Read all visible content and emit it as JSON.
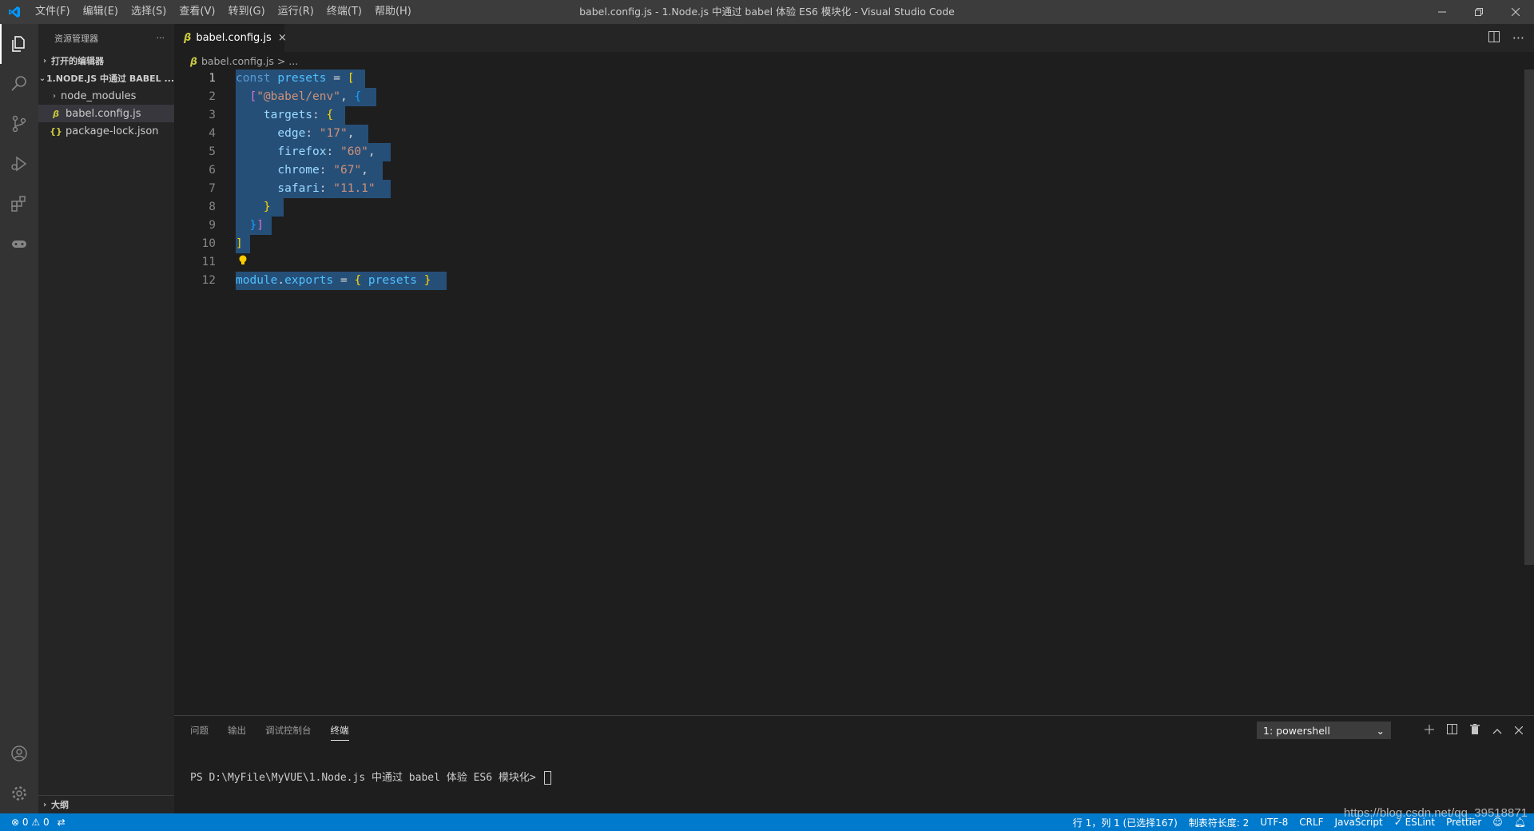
{
  "window": {
    "title": "babel.config.js - 1.Node.js 中通过 babel 体验 ES6 模块化 - Visual Studio Code",
    "menu": [
      "文件(F)",
      "编辑(E)",
      "选择(S)",
      "查看(V)",
      "转到(G)",
      "运行(R)",
      "终端(T)",
      "帮助(H)"
    ]
  },
  "sidebar": {
    "title": "资源管理器",
    "more": "···",
    "open_editors": "打开的编辑器",
    "project": "1.NODE.JS 中通过 BABEL ...",
    "items": [
      {
        "label": "node_modules",
        "kind": "folder"
      },
      {
        "label": "babel.config.js",
        "kind": "js"
      },
      {
        "label": "package-lock.json",
        "kind": "json"
      }
    ],
    "outline": "大纲"
  },
  "tab": {
    "label": "babel.config.js",
    "close": "×"
  },
  "breadcrumb": {
    "file": "babel.config.js",
    "sep": ">",
    "rest": "..."
  },
  "editor": {
    "line_numbers": [
      "1",
      "2",
      "3",
      "4",
      "5",
      "6",
      "7",
      "8",
      "9",
      "10",
      "11",
      "12"
    ]
  },
  "panel": {
    "tabs": [
      "问题",
      "输出",
      "调试控制台",
      "终端"
    ],
    "terminal_select": "1: powershell",
    "prompt": "PS D:\\MyFile\\MyVUE\\1.Node.js 中通过 babel 体验 ES6 模块化> "
  },
  "status": {
    "errors": "0",
    "warnings": "0",
    "position": "行 1，列 1 (已选择167)",
    "tab_size": "制表符长度: 2",
    "encoding": "UTF-8",
    "eol": "CRLF",
    "language": "JavaScript",
    "eslint": "✓ ESLint",
    "prettier": "Prettier"
  },
  "watermark": "https://blog.csdn.net/qq_39518871",
  "colors": {
    "accent": "#007acc",
    "selection": "#264f78",
    "keyword": "#569cd6",
    "string": "#ce9178",
    "property": "#9cdcfe"
  }
}
